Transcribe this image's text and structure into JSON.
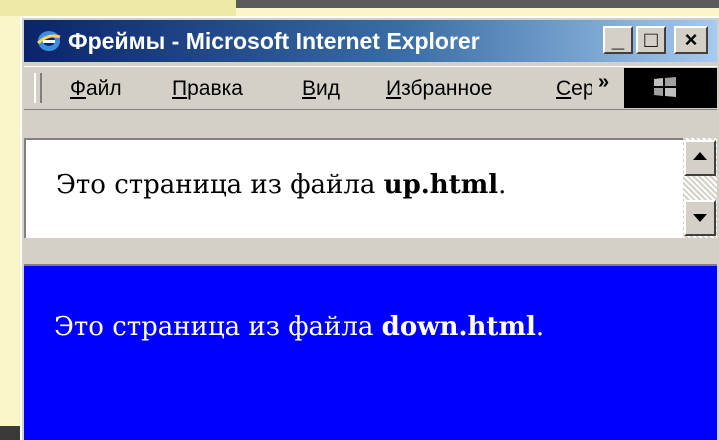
{
  "window": {
    "title": "Фреймы - Microsoft Internet Explorer",
    "icon": "internet-explorer-icon",
    "controls": {
      "minimize": "_",
      "maximize": "□",
      "close": "×"
    }
  },
  "menubar": {
    "items": [
      {
        "label": "Файл",
        "accel": "Ф",
        "rest": "айл"
      },
      {
        "label": "Правка",
        "accel": "П",
        "rest": "равка"
      },
      {
        "label": "Вид",
        "accel": "В",
        "rest": "ид"
      },
      {
        "label": "Избранное",
        "accel": "И",
        "rest": "збранное"
      },
      {
        "label": "Сервис",
        "accel": "С",
        "rest": "ервис"
      }
    ],
    "overflow": "»",
    "logo": "windows-flag-icon"
  },
  "frames": {
    "top": {
      "prefix": "Это страница из файла ",
      "filename": "up.html",
      "suffix": ".",
      "background": "#ffffff",
      "text_color": "#000000"
    },
    "bottom": {
      "prefix": "Это страница из файла ",
      "filename": "down.html",
      "suffix": ".",
      "background": "#0000ff",
      "text_color": "#ffffff"
    }
  },
  "colors": {
    "title_gradient_start": "#0a246a",
    "title_gradient_end": "#a6caf0",
    "chrome": "#d4d0c8",
    "slide_background": "#fbf6c8"
  }
}
